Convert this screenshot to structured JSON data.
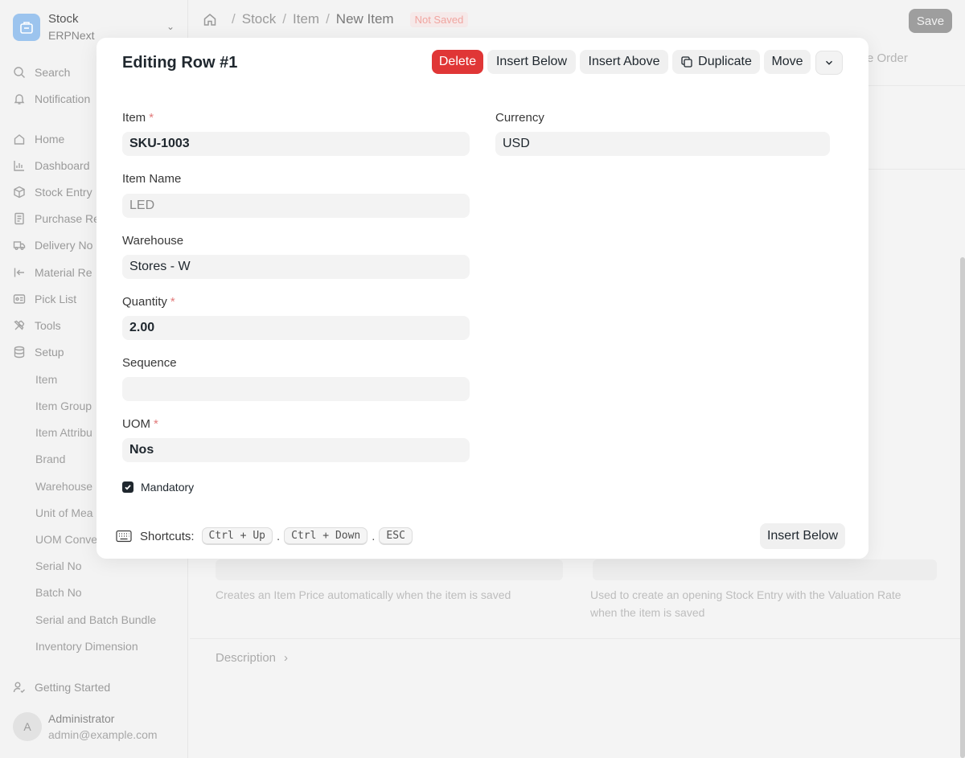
{
  "app": {
    "name": "Stock",
    "subtitle": "ERPNext"
  },
  "sidebar": {
    "search": "Search",
    "notifications": "Notification",
    "items": [
      {
        "label": "Home",
        "icon": "home-icon"
      },
      {
        "label": "Dashboard",
        "icon": "dashboard-icon"
      },
      {
        "label": "Stock Entry",
        "icon": "box-icon"
      },
      {
        "label": "Purchase Re",
        "icon": "receipt-icon"
      },
      {
        "label": "Delivery No",
        "icon": "truck-icon"
      },
      {
        "label": "Material Re",
        "icon": "arrow-left-icon"
      },
      {
        "label": "Pick List",
        "icon": "pick-list-icon"
      },
      {
        "label": "Tools",
        "icon": "tools-icon"
      },
      {
        "label": "Setup",
        "icon": "database-icon"
      }
    ],
    "sub_items": [
      "Item",
      "Item Group",
      "Item Attribu",
      "Brand",
      "Warehouse",
      "Unit of Mea",
      "UOM Conve",
      "Serial No",
      "Batch No",
      "Serial and Batch Bundle",
      "Inventory Dimension"
    ],
    "getting_started": "Getting Started",
    "user": {
      "initial": "A",
      "name": "Administrator",
      "email": "admin@example.com"
    }
  },
  "topbar": {
    "breadcrumbs": [
      "Stock",
      "Item",
      "New Item"
    ],
    "status": "Not Saved",
    "save_label": "Save"
  },
  "background": {
    "order_text": "re Order",
    "help_left": "Creates an Item Price automatically when the item is saved",
    "help_right": "Used to create an opening Stock Entry with the Valuation Rate when the item is saved",
    "description_label": "Description"
  },
  "modal": {
    "title": "Editing Row #1",
    "buttons": {
      "delete": "Delete",
      "insert_below": "Insert Below",
      "insert_above": "Insert Above",
      "duplicate": "Duplicate",
      "move": "Move"
    },
    "fields": {
      "item": {
        "label": "Item",
        "required": "*",
        "value": "SKU-1003"
      },
      "item_name": {
        "label": "Item Name",
        "value": "LED"
      },
      "warehouse": {
        "label": "Warehouse",
        "value": "Stores - W"
      },
      "quantity": {
        "label": "Quantity",
        "required": "*",
        "value": "2.00"
      },
      "sequence": {
        "label": "Sequence",
        "value": ""
      },
      "uom": {
        "label": "UOM",
        "required": "*",
        "value": "Nos"
      },
      "currency": {
        "label": "Currency",
        "value": "USD"
      }
    },
    "mandatory": {
      "label": "Mandatory",
      "checked": true
    },
    "shortcuts": {
      "label": "Shortcuts:",
      "keys": [
        "Ctrl + Up",
        "Ctrl + Down",
        "ESC"
      ],
      "separator": "."
    },
    "footer_insert_below": "Insert Below"
  },
  "colors": {
    "danger": "#e03636",
    "text": "#1f272e",
    "input_bg": "#f3f3f3"
  }
}
